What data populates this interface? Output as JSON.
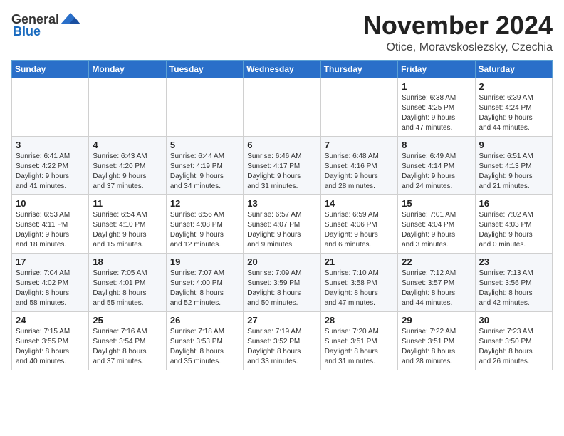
{
  "logo": {
    "general": "General",
    "blue": "Blue"
  },
  "title": "November 2024",
  "subtitle": "Otice, Moravskoslezsky, Czechia",
  "headers": [
    "Sunday",
    "Monday",
    "Tuesday",
    "Wednesday",
    "Thursday",
    "Friday",
    "Saturday"
  ],
  "weeks": [
    [
      {
        "day": "",
        "info": ""
      },
      {
        "day": "",
        "info": ""
      },
      {
        "day": "",
        "info": ""
      },
      {
        "day": "",
        "info": ""
      },
      {
        "day": "",
        "info": ""
      },
      {
        "day": "1",
        "info": "Sunrise: 6:38 AM\nSunset: 4:25 PM\nDaylight: 9 hours\nand 47 minutes."
      },
      {
        "day": "2",
        "info": "Sunrise: 6:39 AM\nSunset: 4:24 PM\nDaylight: 9 hours\nand 44 minutes."
      }
    ],
    [
      {
        "day": "3",
        "info": "Sunrise: 6:41 AM\nSunset: 4:22 PM\nDaylight: 9 hours\nand 41 minutes."
      },
      {
        "day": "4",
        "info": "Sunrise: 6:43 AM\nSunset: 4:20 PM\nDaylight: 9 hours\nand 37 minutes."
      },
      {
        "day": "5",
        "info": "Sunrise: 6:44 AM\nSunset: 4:19 PM\nDaylight: 9 hours\nand 34 minutes."
      },
      {
        "day": "6",
        "info": "Sunrise: 6:46 AM\nSunset: 4:17 PM\nDaylight: 9 hours\nand 31 minutes."
      },
      {
        "day": "7",
        "info": "Sunrise: 6:48 AM\nSunset: 4:16 PM\nDaylight: 9 hours\nand 28 minutes."
      },
      {
        "day": "8",
        "info": "Sunrise: 6:49 AM\nSunset: 4:14 PM\nDaylight: 9 hours\nand 24 minutes."
      },
      {
        "day": "9",
        "info": "Sunrise: 6:51 AM\nSunset: 4:13 PM\nDaylight: 9 hours\nand 21 minutes."
      }
    ],
    [
      {
        "day": "10",
        "info": "Sunrise: 6:53 AM\nSunset: 4:11 PM\nDaylight: 9 hours\nand 18 minutes."
      },
      {
        "day": "11",
        "info": "Sunrise: 6:54 AM\nSunset: 4:10 PM\nDaylight: 9 hours\nand 15 minutes."
      },
      {
        "day": "12",
        "info": "Sunrise: 6:56 AM\nSunset: 4:08 PM\nDaylight: 9 hours\nand 12 minutes."
      },
      {
        "day": "13",
        "info": "Sunrise: 6:57 AM\nSunset: 4:07 PM\nDaylight: 9 hours\nand 9 minutes."
      },
      {
        "day": "14",
        "info": "Sunrise: 6:59 AM\nSunset: 4:06 PM\nDaylight: 9 hours\nand 6 minutes."
      },
      {
        "day": "15",
        "info": "Sunrise: 7:01 AM\nSunset: 4:04 PM\nDaylight: 9 hours\nand 3 minutes."
      },
      {
        "day": "16",
        "info": "Sunrise: 7:02 AM\nSunset: 4:03 PM\nDaylight: 9 hours\nand 0 minutes."
      }
    ],
    [
      {
        "day": "17",
        "info": "Sunrise: 7:04 AM\nSunset: 4:02 PM\nDaylight: 8 hours\nand 58 minutes."
      },
      {
        "day": "18",
        "info": "Sunrise: 7:05 AM\nSunset: 4:01 PM\nDaylight: 8 hours\nand 55 minutes."
      },
      {
        "day": "19",
        "info": "Sunrise: 7:07 AM\nSunset: 4:00 PM\nDaylight: 8 hours\nand 52 minutes."
      },
      {
        "day": "20",
        "info": "Sunrise: 7:09 AM\nSunset: 3:59 PM\nDaylight: 8 hours\nand 50 minutes."
      },
      {
        "day": "21",
        "info": "Sunrise: 7:10 AM\nSunset: 3:58 PM\nDaylight: 8 hours\nand 47 minutes."
      },
      {
        "day": "22",
        "info": "Sunrise: 7:12 AM\nSunset: 3:57 PM\nDaylight: 8 hours\nand 44 minutes."
      },
      {
        "day": "23",
        "info": "Sunrise: 7:13 AM\nSunset: 3:56 PM\nDaylight: 8 hours\nand 42 minutes."
      }
    ],
    [
      {
        "day": "24",
        "info": "Sunrise: 7:15 AM\nSunset: 3:55 PM\nDaylight: 8 hours\nand 40 minutes."
      },
      {
        "day": "25",
        "info": "Sunrise: 7:16 AM\nSunset: 3:54 PM\nDaylight: 8 hours\nand 37 minutes."
      },
      {
        "day": "26",
        "info": "Sunrise: 7:18 AM\nSunset: 3:53 PM\nDaylight: 8 hours\nand 35 minutes."
      },
      {
        "day": "27",
        "info": "Sunrise: 7:19 AM\nSunset: 3:52 PM\nDaylight: 8 hours\nand 33 minutes."
      },
      {
        "day": "28",
        "info": "Sunrise: 7:20 AM\nSunset: 3:51 PM\nDaylight: 8 hours\nand 31 minutes."
      },
      {
        "day": "29",
        "info": "Sunrise: 7:22 AM\nSunset: 3:51 PM\nDaylight: 8 hours\nand 28 minutes."
      },
      {
        "day": "30",
        "info": "Sunrise: 7:23 AM\nSunset: 3:50 PM\nDaylight: 8 hours\nand 26 minutes."
      }
    ]
  ]
}
